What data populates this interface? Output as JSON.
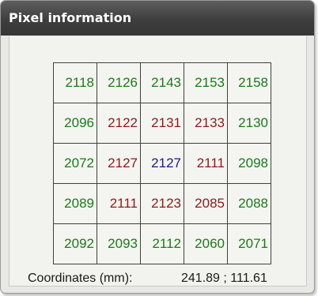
{
  "window": {
    "title": "Pixel information"
  },
  "colors": {
    "normal": "#1a7a1a",
    "darker": "#8b1a1a",
    "center": "#1a1a8b"
  },
  "grid": {
    "rows": [
      [
        {
          "v": "2118",
          "c": "normal"
        },
        {
          "v": "2126",
          "c": "normal"
        },
        {
          "v": "2143",
          "c": "normal"
        },
        {
          "v": "2153",
          "c": "normal"
        },
        {
          "v": "2158",
          "c": "normal"
        }
      ],
      [
        {
          "v": "2096",
          "c": "normal"
        },
        {
          "v": "2122",
          "c": "darker"
        },
        {
          "v": "2131",
          "c": "darker"
        },
        {
          "v": "2133",
          "c": "darker"
        },
        {
          "v": "2130",
          "c": "normal"
        }
      ],
      [
        {
          "v": "2072",
          "c": "normal"
        },
        {
          "v": "2127",
          "c": "darker"
        },
        {
          "v": "2127",
          "c": "center"
        },
        {
          "v": "2111",
          "c": "darker"
        },
        {
          "v": "2098",
          "c": "normal"
        }
      ],
      [
        {
          "v": "2089",
          "c": "normal"
        },
        {
          "v": "2111",
          "c": "darker"
        },
        {
          "v": "2123",
          "c": "darker"
        },
        {
          "v": "2085",
          "c": "darker"
        },
        {
          "v": "2088",
          "c": "normal"
        }
      ],
      [
        {
          "v": "2092",
          "c": "normal"
        },
        {
          "v": "2093",
          "c": "normal"
        },
        {
          "v": "2112",
          "c": "normal"
        },
        {
          "v": "2060",
          "c": "normal"
        },
        {
          "v": "2071",
          "c": "normal"
        }
      ]
    ]
  },
  "footer": {
    "label": "Coordinates (mm):",
    "value": "241.89 ; 111.61"
  }
}
